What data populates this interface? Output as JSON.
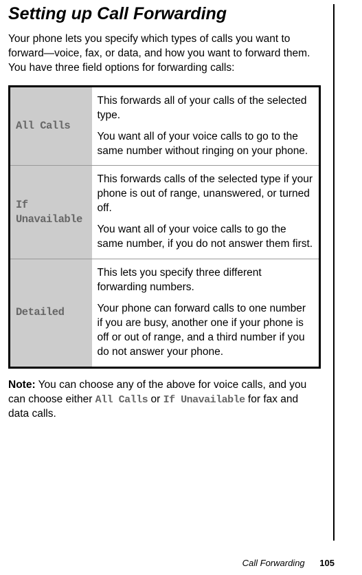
{
  "heading": "Setting up Call Forwarding",
  "intro": "Your phone lets you specify which types of calls you want to forward—voice, fax, or data, and how you want to forward them. You have three field options for forwarding calls:",
  "options": [
    {
      "label": "All Calls",
      "desc1": "This forwards all of your calls of the selected type.",
      "desc2": "You want all of your voice calls to go to the same number without ringing on your phone."
    },
    {
      "label": "If Unavailable",
      "desc1": "This forwards calls of the selected type if your phone is out of range, unanswered, or turned off.",
      "desc2": "You want all of your voice calls to go the same number, if you do not answer them first."
    },
    {
      "label": "Detailed",
      "desc1": "This lets you specify three different forwarding numbers.",
      "desc2": "Your phone can forward calls to one number if you are busy, another one if your phone is off or out of range, and a third number if you do not answer your phone."
    }
  ],
  "note_prefix": "Note:",
  "note_part1": " You can choose any of the above for voice calls, and you can choose either ",
  "note_mono1": "All Calls",
  "note_part2": " or ",
  "note_mono2": "If Unavailable",
  "note_part3": " for fax and data calls.",
  "footer_label": "Call Forwarding",
  "footer_page": "105"
}
